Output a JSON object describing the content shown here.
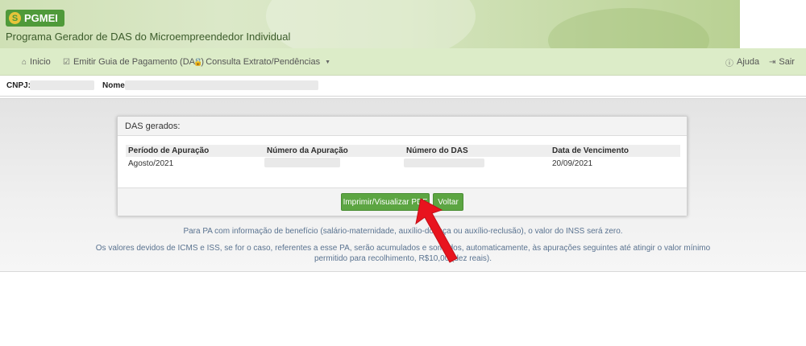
{
  "header": {
    "logo_text": "PGMEI",
    "logo_mark": "S",
    "title": "Programa Gerador de DAS do Microempreendedor Individual"
  },
  "nav": {
    "items": [
      {
        "label": "Inicio",
        "icon": "home-icon",
        "glyph": "⌂"
      },
      {
        "label": "Emitir Guia de Pagamento (DAS)",
        "icon": "checkbox-icon",
        "glyph": "☑"
      },
      {
        "label": "Consulta Extrato/Pendências",
        "icon": "lock-icon",
        "glyph": "🔒"
      }
    ],
    "right": [
      {
        "label": "Ajuda",
        "icon": "info-icon",
        "glyph": "ⓘ"
      },
      {
        "label": "Sair",
        "icon": "logout-icon",
        "glyph": "⇥"
      }
    ]
  },
  "identity": {
    "cnpj_label": "CNPJ:",
    "name_label": "Nome:"
  },
  "das_panel": {
    "heading": "DAS gerados:",
    "columns": [
      "Período de Apuração",
      "Número da Apuração",
      "Número do DAS",
      "Data de Vencimento"
    ],
    "rows": [
      {
        "periodo": "Agosto/2021",
        "vencimento": "20/09/2021"
      }
    ],
    "print_button": "Imprimir/Visualizar PDF",
    "back_button": "Voltar"
  },
  "notes": {
    "line1": "Para PA com informação de benefício (salário-maternidade, auxílio-doença ou auxílio-reclusão), o valor do INSS será zero.",
    "line2a": "Os valores devidos de ICMS e ISS, se for o caso, referentes a esse PA, serão acumulados e somados, automaticamente, às apurações seguintes até atingir o valor mínimo",
    "line2b": "permitido para recolhimento, R$10,00 (dez reais)."
  },
  "colors": {
    "brand_green": "#5ca542",
    "nav_bg": "#dcecc8",
    "annotation_arrow": "#e8141e"
  }
}
